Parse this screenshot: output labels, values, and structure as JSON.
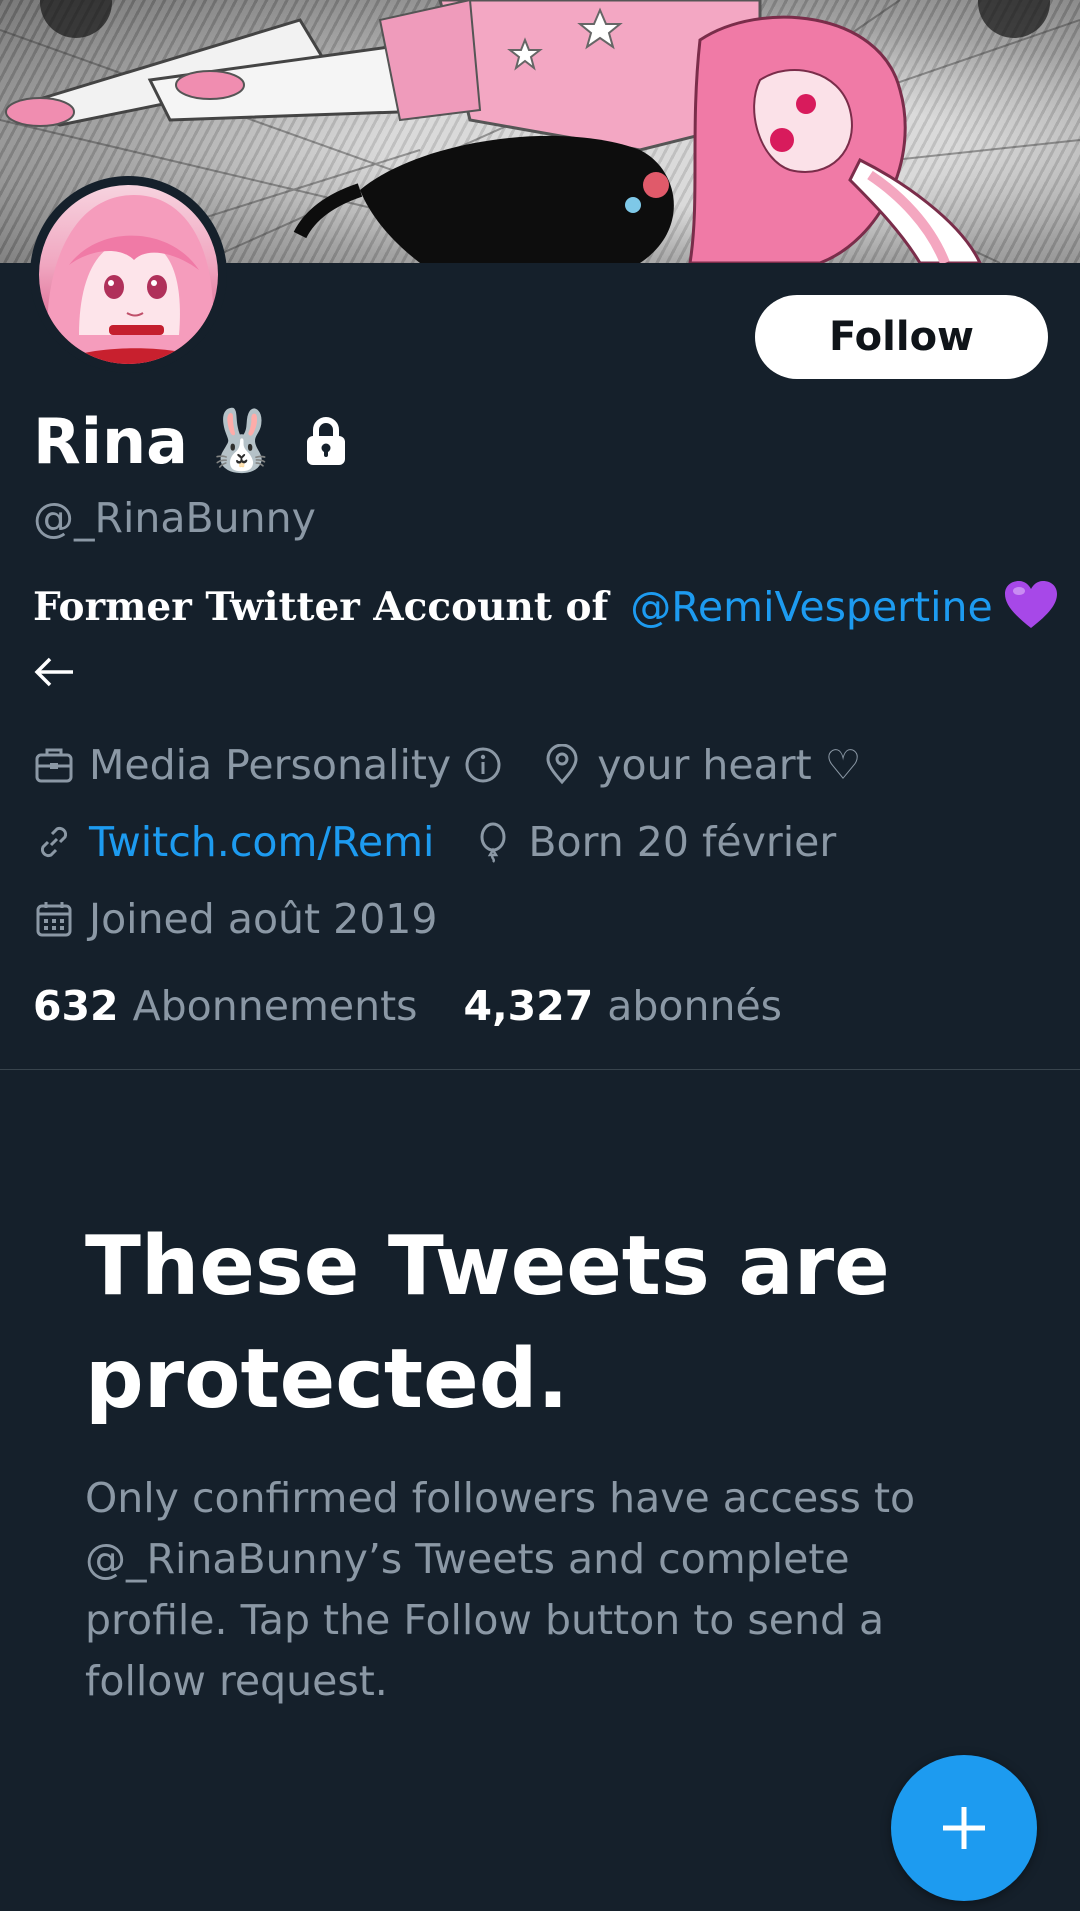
{
  "profile": {
    "display_name": "Rina",
    "name_emoji": "🐰",
    "handle": "@_RinaBunny",
    "bio": {
      "prefix": "Former Twitter Account of",
      "mention": "@RemiVespertine",
      "emoji": "💜"
    },
    "meta": {
      "category": "Media Personality",
      "location": "your heart ♡",
      "website": "Twitch.com/Remi",
      "birthday": "Born 20 février",
      "joined": "Joined août 2019"
    },
    "stats": {
      "following_count": "632",
      "following_label": "Abonnements",
      "followers_count": "4,327",
      "followers_label": "abonnés"
    }
  },
  "actions": {
    "follow_label": "Follow"
  },
  "protected": {
    "title": "These Tweets are protected.",
    "description": "Only confirmed followers have access to @_RinaBunny’s Tweets and complete profile. Tap the Follow button to send a follow request."
  },
  "colors": {
    "background": "#15202b",
    "accent": "#1d9bf0",
    "secondary_text": "#8b98a5",
    "divider": "#38444d"
  },
  "icons": {
    "lock": "lock-icon",
    "category": "briefcase-icon",
    "info": "info-icon",
    "location": "location-pin-icon",
    "website": "link-icon",
    "birthday": "balloon-icon",
    "joined": "calendar-icon",
    "back": "arrow-left-icon",
    "compose": "plus-icon"
  }
}
